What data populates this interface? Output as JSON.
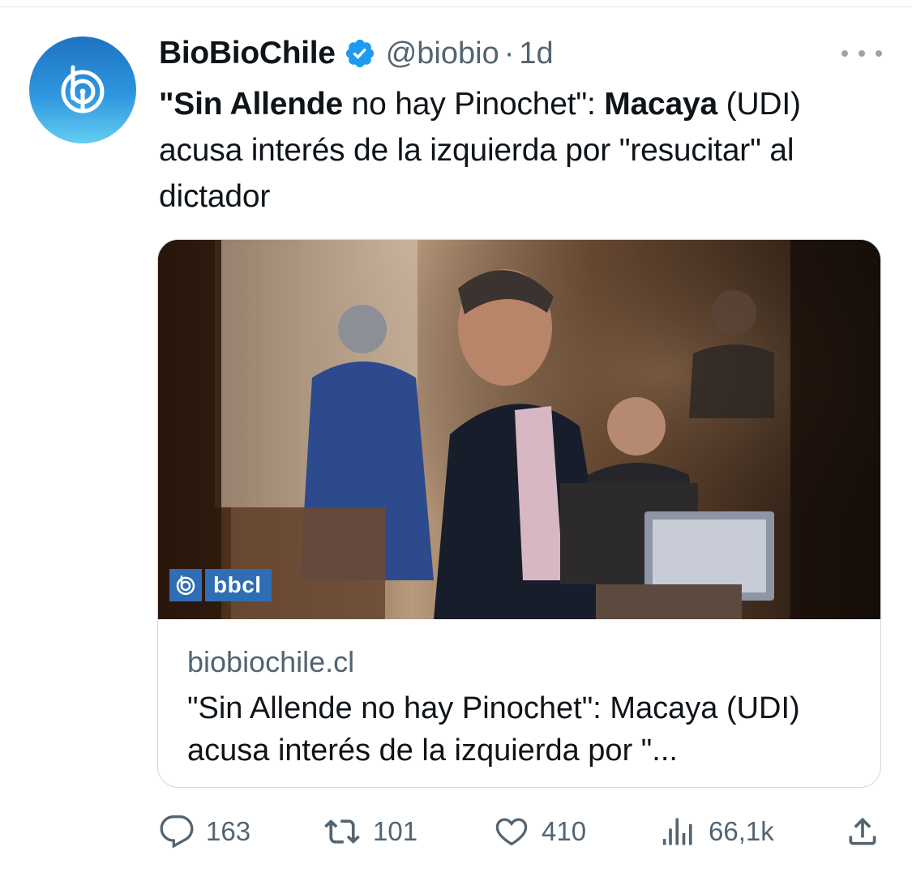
{
  "tweet": {
    "author_name": "BioBioChile",
    "handle": "@biobio",
    "separator": "·",
    "time": "1d",
    "text_parts": [
      {
        "text": "\"Sin Allende",
        "bold": true
      },
      {
        "text": " no hay Pinochet\": ",
        "bold": false
      },
      {
        "text": "Macaya",
        "bold": true
      },
      {
        "text": " (UDI) acusa interés de la izquierda por \"resucitar\" al dictador",
        "bold": false
      }
    ]
  },
  "card": {
    "watermark_text": "bbcl",
    "domain": "biobiochile.cl",
    "title": "\"Sin Allende no hay Pinochet\": Macaya (UDI) acusa interés de la izquierda por \"..."
  },
  "actions": {
    "replies": "163",
    "reposts": "101",
    "likes": "410",
    "views": "66,1k"
  },
  "icons": {
    "avatar": "biobio-logo-icon",
    "verified": "verified-badge-icon",
    "more": "more-options-icon",
    "reply": "reply-icon",
    "repost": "repost-icon",
    "like": "heart-icon",
    "views": "views-chart-icon",
    "share": "share-icon"
  },
  "colors": {
    "verified": "#1d9bf0",
    "avatar_top": "#1e73c2",
    "avatar_bottom": "#63cdf0",
    "secondary_text": "#536471",
    "watermark_bg": "#2f6db5"
  }
}
